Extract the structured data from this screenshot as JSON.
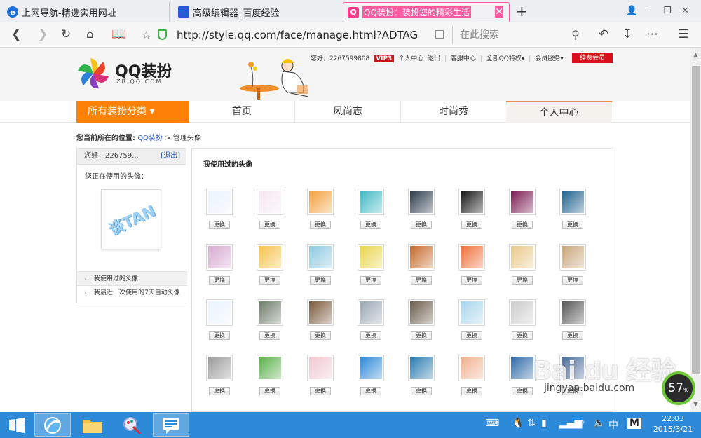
{
  "browser": {
    "tabs": [
      {
        "title": "上网导航-精选实用网址",
        "icon": "ie-icon"
      },
      {
        "title": "高级编辑器_百度经验",
        "icon": "baidu-paw-icon"
      },
      {
        "title": "QQ装扮：装扮您的精彩生活",
        "icon": "qq-icon",
        "active": true
      }
    ],
    "close_glyph": "✕",
    "new_tab_glyph": "+",
    "url": "http://style.qq.com/face/manage.html?ADTAG",
    "search_placeholder": "在此搜索",
    "window_controls": {
      "user": "👤",
      "minimize": "–",
      "restore": "❐",
      "close": "✕"
    }
  },
  "header": {
    "brand": "QQ装扮",
    "brand_sub": "ZB.QQ.COM",
    "greeting": "您好，2267599808",
    "vip_badge": "VIP3",
    "links": [
      "个人中心",
      "退出",
      "|",
      "客服中心",
      "|",
      "全部QQ特权▾",
      "|",
      "会员服务▾"
    ],
    "renew_button": "续费会员"
  },
  "main_nav": {
    "category": "所有装扮分类 ▾",
    "items": [
      "首页",
      "风尚志",
      "时尚秀",
      "个人中心"
    ]
  },
  "breadcrumb": {
    "label": "您当前所在的位置:",
    "link": "QQ装扮",
    "sep": ">",
    "current": "管理头像"
  },
  "sidebar": {
    "greeting": "您好，226759...",
    "logout": "[退出]",
    "current_label": "您正在使用的头像：",
    "current_avatar_text": "谈TAN",
    "menu": [
      "我使用过的头像",
      "我最近一次使用的7天自动头像"
    ]
  },
  "panel": {
    "title": "我使用过的头像",
    "change_label": "更换",
    "avatars": [
      {
        "name": "tan-avatar",
        "color": "#eaf3ff"
      },
      {
        "name": "pastel-castle-avatar",
        "color": "#f6e6f0"
      },
      {
        "name": "color-pencils-avatar",
        "color": "#f2a03a"
      },
      {
        "name": "red-bird-avatar",
        "color": "#3db8c4"
      },
      {
        "name": "night-city-avatar",
        "color": "#2a3a4a"
      },
      {
        "name": "window-silhouette-avatar",
        "color": "#111111"
      },
      {
        "name": "purple-elephant-avatar",
        "color": "#7a1a52"
      },
      {
        "name": "runner-sign-avatar",
        "color": "#1c5f8c"
      },
      {
        "name": "macarons-avatar",
        "color": "#d7a8d0"
      },
      {
        "name": "color-fan-avatar",
        "color": "#f5c24a"
      },
      {
        "name": "rainbow-rose-avatar",
        "color": "#8bc8e0"
      },
      {
        "name": "colorful-star-avatar",
        "color": "#e8d44a"
      },
      {
        "name": "girl-portrait-avatar",
        "color": "#c76a2a"
      },
      {
        "name": "rainbow-heart-avatar",
        "color": "#f06f3a"
      },
      {
        "name": "pencil-tips-avatar",
        "color": "#e8c88a"
      },
      {
        "name": "vintage-room-avatar",
        "color": "#c9a67a"
      },
      {
        "name": "tan-avatar-2",
        "color": "#eaf3ff"
      },
      {
        "name": "bicycle-avatar",
        "color": "#6d7c6a"
      },
      {
        "name": "guitarist-avatar",
        "color": "#7a5a3a"
      },
      {
        "name": "sheet-music-avatar",
        "color": "#9aa6b4"
      },
      {
        "name": "musical-notes-avatar",
        "color": "#6a5c4a"
      },
      {
        "name": "notes-line-avatar",
        "color": "#a8d4ec"
      },
      {
        "name": "treble-clef-avatar",
        "color": "#cccccc"
      },
      {
        "name": "cat-bw-avatar",
        "color": "#555555"
      },
      {
        "name": "swirl-bw-avatar",
        "color": "#9a9a9a"
      },
      {
        "name": "origami-bird-avatar",
        "color": "#5ab04a"
      },
      {
        "name": "macaron-row-avatar",
        "color": "#f0c8d0"
      },
      {
        "name": "blue-parrot-avatar",
        "color": "#2a88d8"
      },
      {
        "name": "rio-bird-avatar",
        "color": "#2a7ab0"
      },
      {
        "name": "baby-face-avatar",
        "color": "#f0b090"
      },
      {
        "name": "blue-macaw-avatar",
        "color": "#2f6aa8"
      },
      {
        "name": "boy-hat-avatar",
        "color": "#4a6a9a"
      }
    ]
  },
  "watermark": {
    "text": "Bai du 经验",
    "url": "jingyan.baidu.com"
  },
  "gauge": {
    "value": "57",
    "unit": "%"
  },
  "taskbar": {
    "apps": [
      "windows-start-icon",
      "browser-icon",
      "folder-icon",
      "paint-icon",
      "notes-icon"
    ],
    "ime": "中",
    "time": "22:03",
    "date": "2015/3/21"
  }
}
